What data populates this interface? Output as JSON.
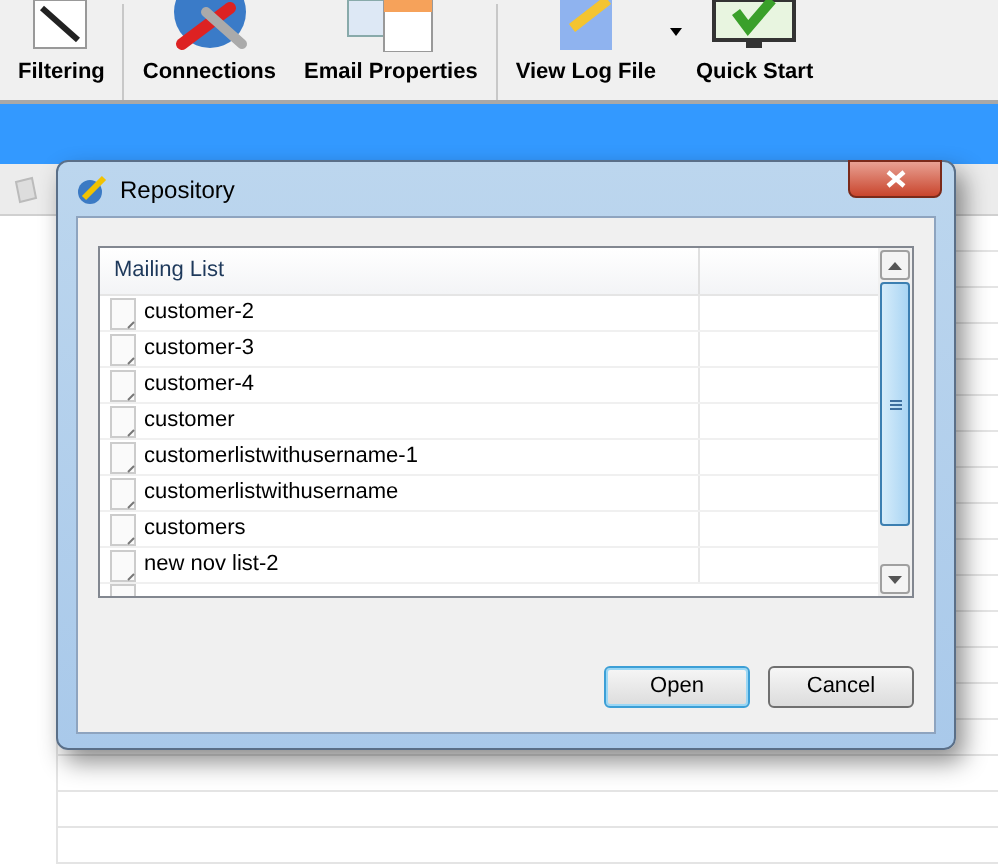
{
  "toolbar": {
    "items": [
      {
        "kind": "button",
        "label": "Filtering"
      },
      {
        "kind": "separator"
      },
      {
        "kind": "button",
        "label": "Connections"
      },
      {
        "kind": "button",
        "label": "Email Properties"
      },
      {
        "kind": "separator"
      },
      {
        "kind": "button",
        "label": "View Log File"
      },
      {
        "kind": "dropdown"
      },
      {
        "kind": "button",
        "label": "Quick Start"
      }
    ]
  },
  "dialog": {
    "title": "Repository",
    "table": {
      "columns": [
        "Mailing List"
      ],
      "rows": [
        {
          "name": "customer-2"
        },
        {
          "name": "customer-3"
        },
        {
          "name": "customer-4"
        },
        {
          "name": "customer"
        },
        {
          "name": "customerlistwithusername-1"
        },
        {
          "name": "customerlistwithusername"
        },
        {
          "name": "customers"
        },
        {
          "name": "new nov list-2"
        }
      ]
    },
    "buttons": [
      {
        "label": "Open",
        "default": true
      },
      {
        "label": "Cancel",
        "default": false
      }
    ]
  }
}
